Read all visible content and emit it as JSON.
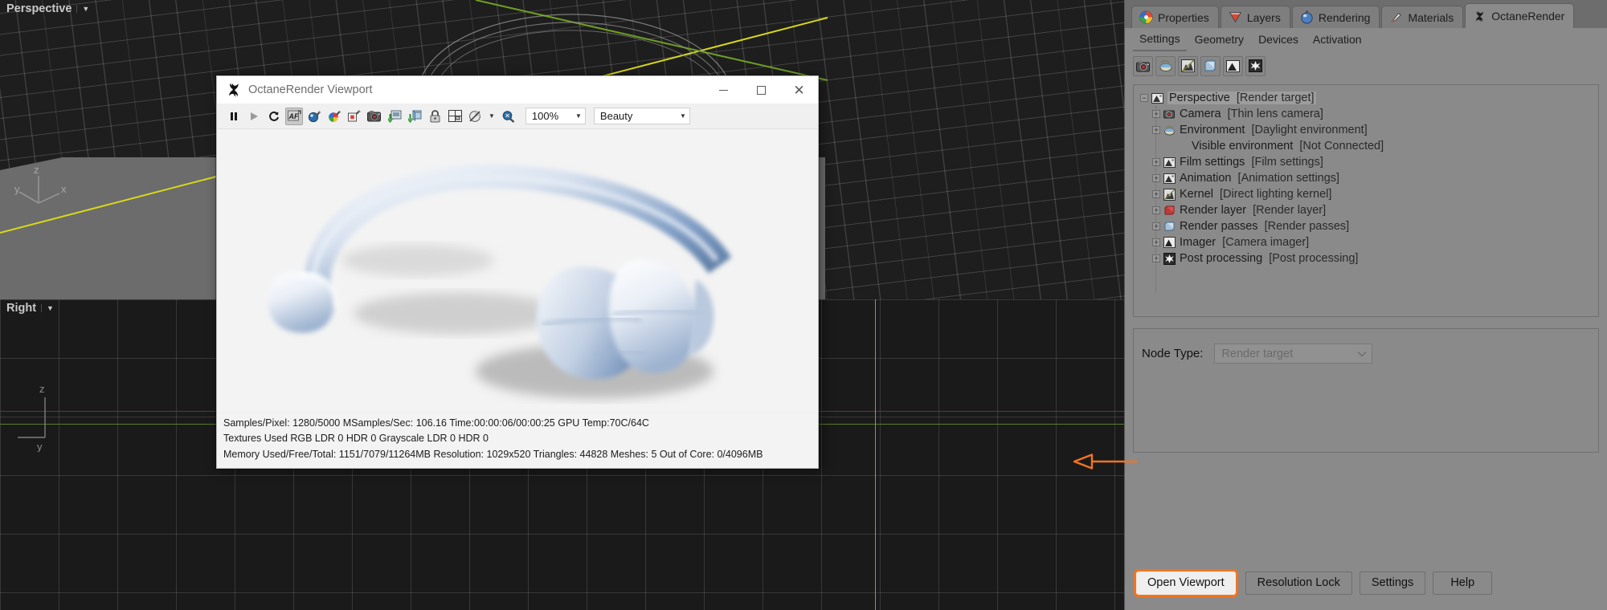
{
  "host": {
    "viewport_top_label": "Perspective",
    "viewport_bottom_label": "Right",
    "axis_x": "x",
    "axis_y": "y",
    "axis_z": "z",
    "axis_z_bottom": "z",
    "axis_y_bottom": "y"
  },
  "octane_window": {
    "title": "OctaneRender Viewport",
    "logo_icon": "octane-logo-icon",
    "window_controls": {
      "minimize": "minimize-icon",
      "maximize": "maximize-icon",
      "close": "close-icon"
    },
    "toolbar": {
      "buttons": [
        {
          "name": "pause-render-button",
          "icon": "pause-icon"
        },
        {
          "name": "start-render-button",
          "icon": "play-icon"
        },
        {
          "name": "restart-render-button",
          "icon": "restart-arrow-icon"
        },
        {
          "name": "autofocus-button",
          "icon": "af-icon",
          "active": true
        },
        {
          "name": "pick-focus-button",
          "icon": "focus-picker-icon"
        },
        {
          "name": "pick-material-button",
          "icon": "color-picker-icon"
        },
        {
          "name": "pick-white-balance-button",
          "icon": "white-balance-picker-icon"
        },
        {
          "name": "camera-button",
          "icon": "camera-icon"
        },
        {
          "name": "save-image-button",
          "icon": "save-image-icon"
        },
        {
          "name": "save-layers-button",
          "icon": "save-layers-icon"
        },
        {
          "name": "resolution-lock-button",
          "icon": "lock-icon"
        },
        {
          "name": "region-render-button",
          "icon": "grid-regions-icon"
        },
        {
          "name": "clay-mode-button",
          "icon": "clay-sphere-icon"
        },
        {
          "name": "clay-mode-dropdown",
          "icon": "chevron-down-icon"
        },
        {
          "name": "zoom-region-button",
          "icon": "magnifier-icon"
        }
      ],
      "zoom_value": "100%",
      "zoom_caret": "chevron-down-icon",
      "pass_value": "Beauty",
      "pass_caret": "chevron-down-icon"
    },
    "status_lines": [
      "Samples/Pixel: 1280/5000  MSamples/Sec: 106.16  Time:00:00:06/00:00:25  GPU Temp:70C/64C",
      "Textures Used RGB LDR 0  HDR 0  Grayscale LDR 0  HDR 0",
      "Memory Used/Free/Total: 1151/7079/11264MB  Resolution: 1029x520  Triangles: 44828  Meshes: 5 Out of Core: 0/4096MB"
    ]
  },
  "dock": {
    "tabs": [
      {
        "label": "Properties",
        "icon": "color-wheel-icon",
        "active": false
      },
      {
        "label": "Layers",
        "icon": "layers-icon",
        "active": false
      },
      {
        "label": "Rendering",
        "icon": "render-sphere-icon",
        "active": false
      },
      {
        "label": "Materials",
        "icon": "material-brush-icon",
        "active": false
      },
      {
        "label": "OctaneRender",
        "icon": "octane-logo-icon",
        "active": true
      }
    ],
    "sub_tabs": [
      {
        "label": "Settings",
        "active": true
      },
      {
        "label": "Geometry",
        "active": false
      },
      {
        "label": "Devices",
        "active": false
      },
      {
        "label": "Activation",
        "active": false
      }
    ],
    "icon_row": [
      {
        "name": "camera-settings-button",
        "icon": "camera-icon"
      },
      {
        "name": "environment-settings-button",
        "icon": "environment-icon"
      },
      {
        "name": "kernel-settings-button",
        "icon": "kernel-icon"
      },
      {
        "name": "render-layer-button",
        "icon": "render-layer-icon"
      },
      {
        "name": "imager-button",
        "icon": "imager-icon"
      },
      {
        "name": "post-processing-button",
        "icon": "post-processing-icon"
      }
    ],
    "tree": [
      {
        "label": "Perspective",
        "type": "[Render target]",
        "icon": "render-target-icon",
        "expander": "collapse",
        "depth": 0,
        "selected": true
      },
      {
        "label": "Camera",
        "type": "[Thin lens camera]",
        "icon": "camera-icon",
        "expander": "expand",
        "depth": 1,
        "selected": false
      },
      {
        "label": "Environment",
        "type": "[Daylight environment]",
        "icon": "environment-icon",
        "expander": "expand",
        "depth": 1,
        "selected": false
      },
      {
        "label": "Visible environment",
        "type": "[Not Connected]",
        "icon": "none",
        "expander": "none",
        "depth": 2,
        "selected": false
      },
      {
        "label": "Film settings",
        "type": "[Film settings]",
        "icon": "film-settings-icon",
        "expander": "expand",
        "depth": 1,
        "selected": false
      },
      {
        "label": "Animation",
        "type": "[Animation settings]",
        "icon": "animation-icon",
        "expander": "expand",
        "depth": 1,
        "selected": false
      },
      {
        "label": "Kernel",
        "type": "[Direct lighting kernel]",
        "icon": "kernel-icon",
        "expander": "expand",
        "depth": 1,
        "selected": false
      },
      {
        "label": "Render layer",
        "type": "[Render layer]",
        "icon": "render-layer-red-icon",
        "expander": "expand",
        "depth": 1,
        "selected": false
      },
      {
        "label": "Render passes",
        "type": "[Render passes]",
        "icon": "render-passes-icon",
        "expander": "expand",
        "depth": 1,
        "selected": false
      },
      {
        "label": "Imager",
        "type": "[Camera imager]",
        "icon": "imager-icon",
        "expander": "expand",
        "depth": 1,
        "selected": false
      },
      {
        "label": "Post processing",
        "type": "[Post processing]",
        "icon": "post-processing-icon",
        "expander": "expand",
        "depth": 1,
        "selected": false
      }
    ],
    "node_type": {
      "label": "Node Type:",
      "value": "Render target",
      "caret": "chevron-down-icon"
    },
    "buttons": [
      {
        "label": "Open Viewport",
        "highlighted": true
      },
      {
        "label": "Resolution Lock",
        "highlighted": false
      },
      {
        "label": "Settings",
        "highlighted": false
      },
      {
        "label": "Help",
        "highlighted": false
      }
    ]
  },
  "annotation": {
    "arrow_icon": "left-arrow-annotation",
    "color": "#f2741f"
  }
}
